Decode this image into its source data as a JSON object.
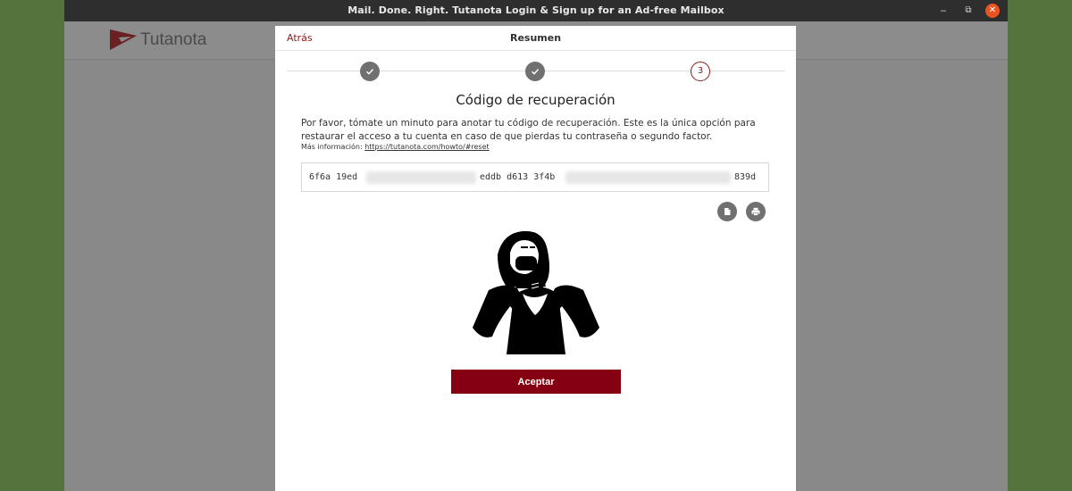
{
  "window": {
    "title": "Mail. Done. Right. Tutanota Login & Sign up for an Ad-free Mailbox",
    "minimize_glyph": "‒",
    "maximize_glyph": "⧉",
    "close_glyph": "✕"
  },
  "app": {
    "logo_text_a": "Tuta",
    "logo_text_b": "nota",
    "brand_color": "#850011"
  },
  "dialog": {
    "back_label": "Atrás",
    "title": "Resumen",
    "steps": [
      {
        "state": "done",
        "label": ""
      },
      {
        "state": "done",
        "label": ""
      },
      {
        "state": "current",
        "label": "3"
      }
    ],
    "heading": "Código de recuperación",
    "description": "Por favor, tómate un minuto para anotar tu código de recuperación. Este es la única opción para restaurar el acceso a tu cuenta en caso de que pierdas tu contraseña o segundo factor.",
    "more_info_label": "Más información:",
    "more_info_link": "https://tutanota.com/howto/#reset",
    "code": {
      "part1": "6f6a 19ed",
      "part2": "eddb d613 3f4b",
      "part3": "839d"
    },
    "copy_icon": "copy-icon",
    "print_icon": "print-icon",
    "accept_label": "Aceptar"
  }
}
